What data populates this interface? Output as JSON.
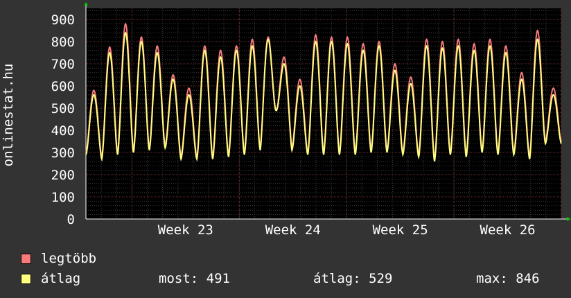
{
  "chart_data": {
    "type": "line",
    "ylabel": "onlinestat.hu",
    "ylim": [
      0,
      950
    ],
    "yticks": [
      0,
      100,
      200,
      300,
      400,
      500,
      600,
      700,
      800,
      900
    ],
    "x_tick_labels": [
      "Week 23",
      "Week 24",
      "Week 25",
      "Week 26"
    ],
    "grid": true,
    "x_days": 31,
    "series": [
      {
        "name": "legtöbb",
        "color": "#f77b7b",
        "daily_peaks": [
          580,
          775,
          880,
          820,
          780,
          650,
          590,
          780,
          760,
          780,
          810,
          820,
          730,
          630,
          830,
          820,
          820,
          790,
          800,
          700,
          640,
          810,
          800,
          810,
          790,
          810,
          780,
          660,
          850,
          590
        ],
        "daily_lows": [
          300,
          280,
          300,
          310,
          320,
          330,
          280,
          280,
          280,
          290,
          300,
          320,
          490,
          320,
          300,
          300,
          300,
          300,
          310,
          310,
          300,
          290,
          270,
          300,
          290,
          310,
          300,
          300,
          280,
          350
        ]
      },
      {
        "name": "átlag",
        "color": "#ffff80",
        "daily_peaks": [
          560,
          750,
          840,
          800,
          750,
          630,
          560,
          760,
          730,
          760,
          780,
          810,
          700,
          600,
          800,
          800,
          790,
          760,
          780,
          670,
          610,
          780,
          770,
          780,
          760,
          780,
          750,
          630,
          810,
          560
        ],
        "daily_lows": [
          290,
          270,
          290,
          300,
          310,
          320,
          270,
          270,
          270,
          280,
          290,
          310,
          490,
          310,
          290,
          290,
          290,
          290,
          300,
          300,
          290,
          280,
          260,
          290,
          280,
          300,
          290,
          290,
          270,
          340
        ]
      }
    ]
  },
  "legend": {
    "max_label": "legtöbb",
    "avg_label": "átlag"
  },
  "stats": {
    "current": "most: 491",
    "average": "átlag: 529",
    "maximum": "max: 846"
  }
}
